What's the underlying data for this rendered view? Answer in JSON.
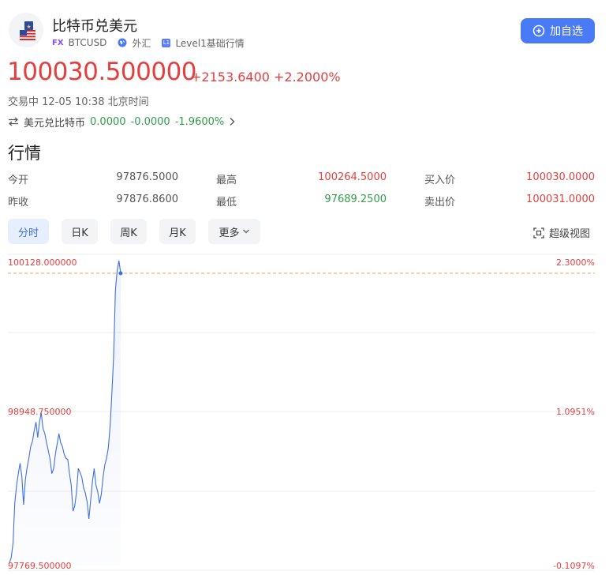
{
  "header": {
    "title": "比特币兑美元",
    "fx_tag": "FX",
    "symbol": "BTCUSD",
    "market": "外汇",
    "level_badge": "L1",
    "level_label": "Level1基础行情",
    "add_button": "加自选"
  },
  "quote": {
    "price": "100030.500000",
    "change": "+2153.6400",
    "change_pct": "+2.2000%",
    "status": "交易中 12-05 10:38 北京时间"
  },
  "inverse": {
    "label": "美元兑比特币",
    "price": "0.0000",
    "change": "-0.0000",
    "change_pct": "-1.9600%"
  },
  "section_title": "行情",
  "stats": {
    "open_label": "今开",
    "open": "97876.5000",
    "high_label": "最高",
    "high": "100264.5000",
    "bid_label": "买入价",
    "bid": "100030.0000",
    "prev_close_label": "昨收",
    "prev_close": "97876.8600",
    "low_label": "最低",
    "low": "97689.2500",
    "ask_label": "卖出价",
    "ask": "100031.0000"
  },
  "tabs": [
    "分时",
    "日K",
    "周K",
    "月K",
    "更多"
  ],
  "super_chart_label": "超级视图",
  "colors": {
    "up": "#e53e3e",
    "down": "#2e9e48",
    "accent": "#4a7bf7",
    "line": "#3d6fe8",
    "ref_line": "#f0a060"
  },
  "chart_data": {
    "type": "line",
    "y_axis_left": [
      "100128.000000",
      "98948.750000",
      "97769.500000"
    ],
    "y_axis_right": [
      "2.3000%",
      "1.0951%",
      "-0.1097%"
    ],
    "ylim": [
      97769.5,
      100128.0
    ],
    "prev_close": 100030.5,
    "series": [
      {
        "values": [
          97790,
          97830,
          97940,
          98250,
          98390,
          98480,
          98560,
          98460,
          98240,
          98430,
          98530,
          98600,
          98690,
          98730,
          98810,
          98880,
          98760,
          98880,
          98950,
          98830,
          98790,
          98720,
          98660,
          98590,
          98480,
          98520,
          98630,
          98710,
          98790,
          98720,
          98690,
          98630,
          98600,
          98590,
          98480,
          98390,
          98190,
          98230,
          98340,
          98520,
          98490,
          98450,
          98370,
          98330,
          98260,
          98130,
          98280,
          98420,
          98520,
          98390,
          98340,
          98250,
          98320,
          98450,
          98550,
          98600,
          98680,
          98850,
          99100,
          99380,
          99900,
          100050,
          100128,
          100030
        ]
      }
    ]
  }
}
